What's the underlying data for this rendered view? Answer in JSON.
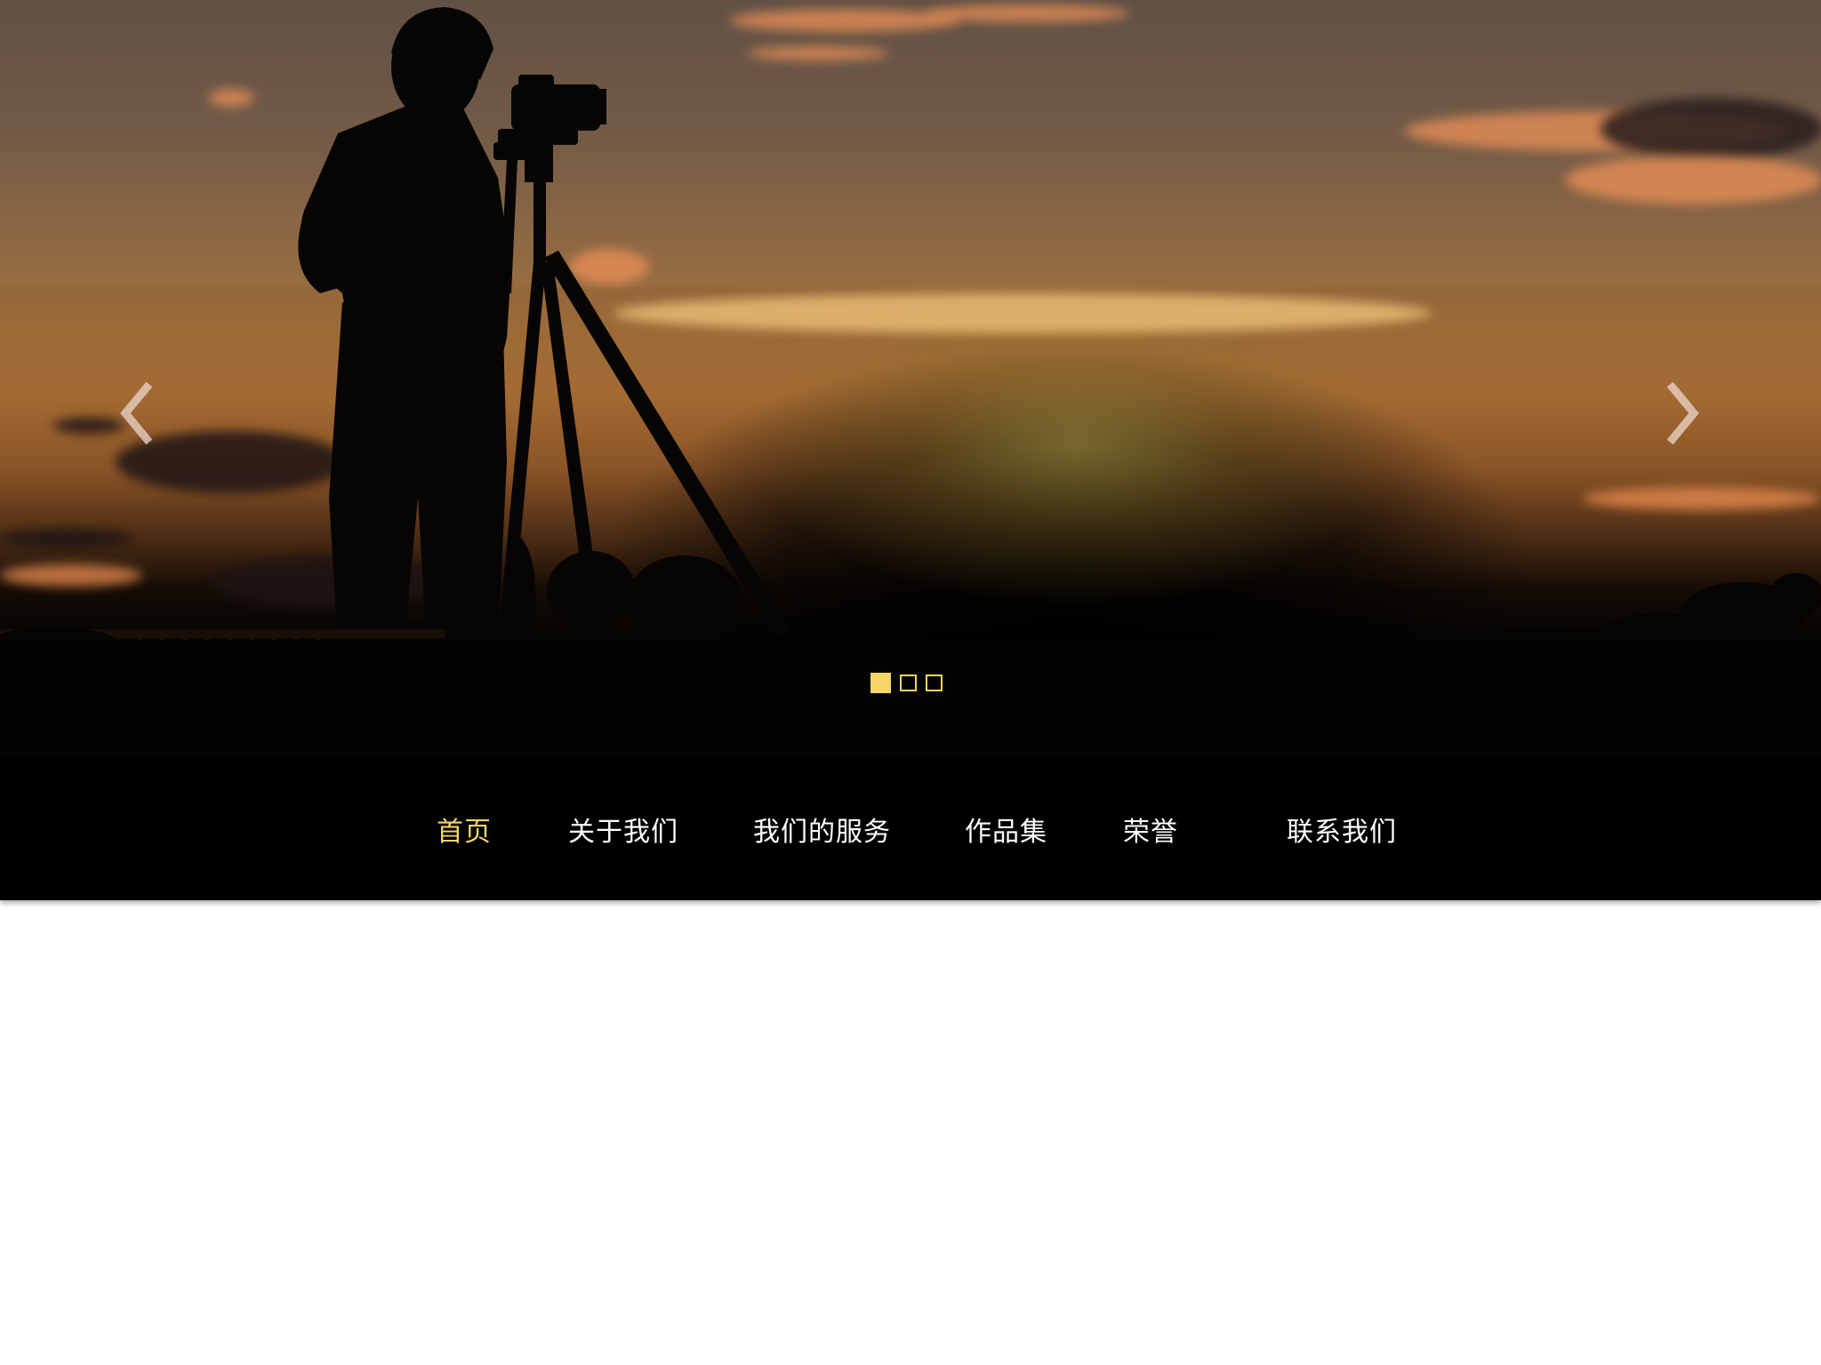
{
  "hero": {
    "prev_label": "‹",
    "next_label": "›",
    "slides_count": 3,
    "active_slide": 1,
    "indicator_color": "#f6d567"
  },
  "nav": {
    "items": [
      {
        "label": "首页",
        "active": true
      },
      {
        "label": "关于我们",
        "active": false
      },
      {
        "label": "我们的服务",
        "active": false
      },
      {
        "label": "作品集",
        "active": false
      },
      {
        "label": "荣誉",
        "active": false
      },
      {
        "label": "联系我们",
        "active": false
      }
    ],
    "active_color": "#f6d567",
    "text_color": "#ffffff",
    "background": "#000000"
  }
}
